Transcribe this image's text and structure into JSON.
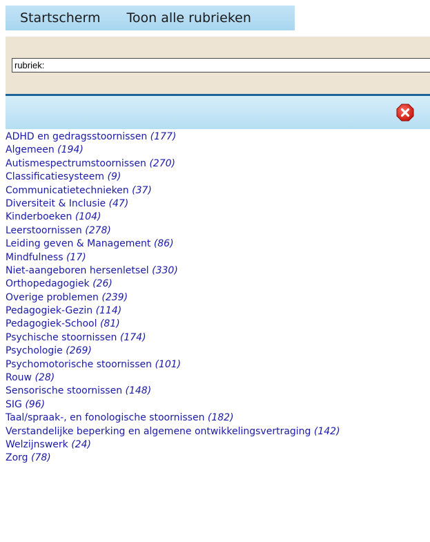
{
  "nav": {
    "home_label": "Startscherm",
    "all_label": "Toon alle rubrieken"
  },
  "search": {
    "value": "rubriek:"
  },
  "colors": {
    "link": "#1a1aa8",
    "nav_bg": "#b5def2",
    "search_bg": "#ede4d3",
    "divider": "#1e6496",
    "close_red": "#e0281c"
  },
  "categories": [
    {
      "name": "ADHD en gedragsstoornissen",
      "count": "(177)"
    },
    {
      "name": "Algemeen",
      "count": "(194)"
    },
    {
      "name": "Autismespectrumstoornissen",
      "count": "(270)"
    },
    {
      "name": "Classificatiesysteem",
      "count": "(9)"
    },
    {
      "name": "Communicatietechnieken",
      "count": "(37)"
    },
    {
      "name": "Diversiteit & Inclusie",
      "count": "(47)"
    },
    {
      "name": "Kinderboeken",
      "count": "(104)"
    },
    {
      "name": "Leerstoornissen",
      "count": "(278)"
    },
    {
      "name": "Leiding geven & Management",
      "count": "(86)"
    },
    {
      "name": "Mindfulness",
      "count": "(17)"
    },
    {
      "name": "Niet-aangeboren hersenletsel",
      "count": "(330)"
    },
    {
      "name": "Orthopedagogiek",
      "count": "(26)"
    },
    {
      "name": "Overige problemen",
      "count": "(239)"
    },
    {
      "name": "Pedagogiek-Gezin",
      "count": "(114)"
    },
    {
      "name": "Pedagogiek-School",
      "count": "(81)"
    },
    {
      "name": "Psychische stoornissen",
      "count": "(174)"
    },
    {
      "name": "Psychologie",
      "count": "(269)"
    },
    {
      "name": "Psychomotorische stoornissen",
      "count": "(101)"
    },
    {
      "name": "Rouw",
      "count": "(28)"
    },
    {
      "name": "Sensorische stoornissen",
      "count": "(148)"
    },
    {
      "name": "SIG",
      "count": "(96)"
    },
    {
      "name": "Taal/spraak-, en fonologische stoornissen",
      "count": "(182)"
    },
    {
      "name": "Verstandelijke beperking en algemene ontwikkelingsvertraging",
      "count": "(142)"
    },
    {
      "name": "Welzijnswerk",
      "count": "(24)"
    },
    {
      "name": "Zorg",
      "count": "(78)"
    }
  ]
}
